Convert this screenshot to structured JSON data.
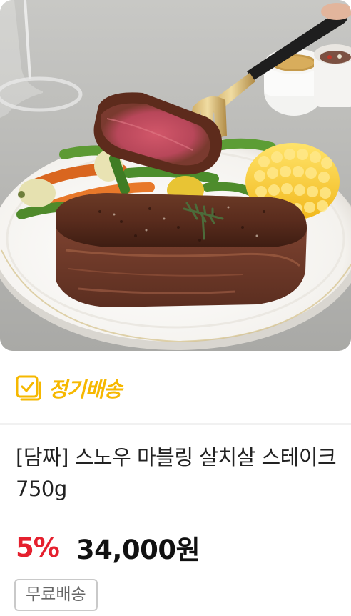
{
  "product": {
    "image_alt": "",
    "subscription_label": "정기배송",
    "title": "[담짜] 스노우 마블링 살치살 스테이크 750g",
    "discount": "5%",
    "price": "34,000원",
    "shipping_badge": "무료배송"
  },
  "colors": {
    "subscription": "#f6b800",
    "discount": "#e5202e",
    "price": "#111111",
    "badge_border": "#c9c9c9"
  },
  "icons": {
    "subscription": "calendar-check-icon"
  }
}
